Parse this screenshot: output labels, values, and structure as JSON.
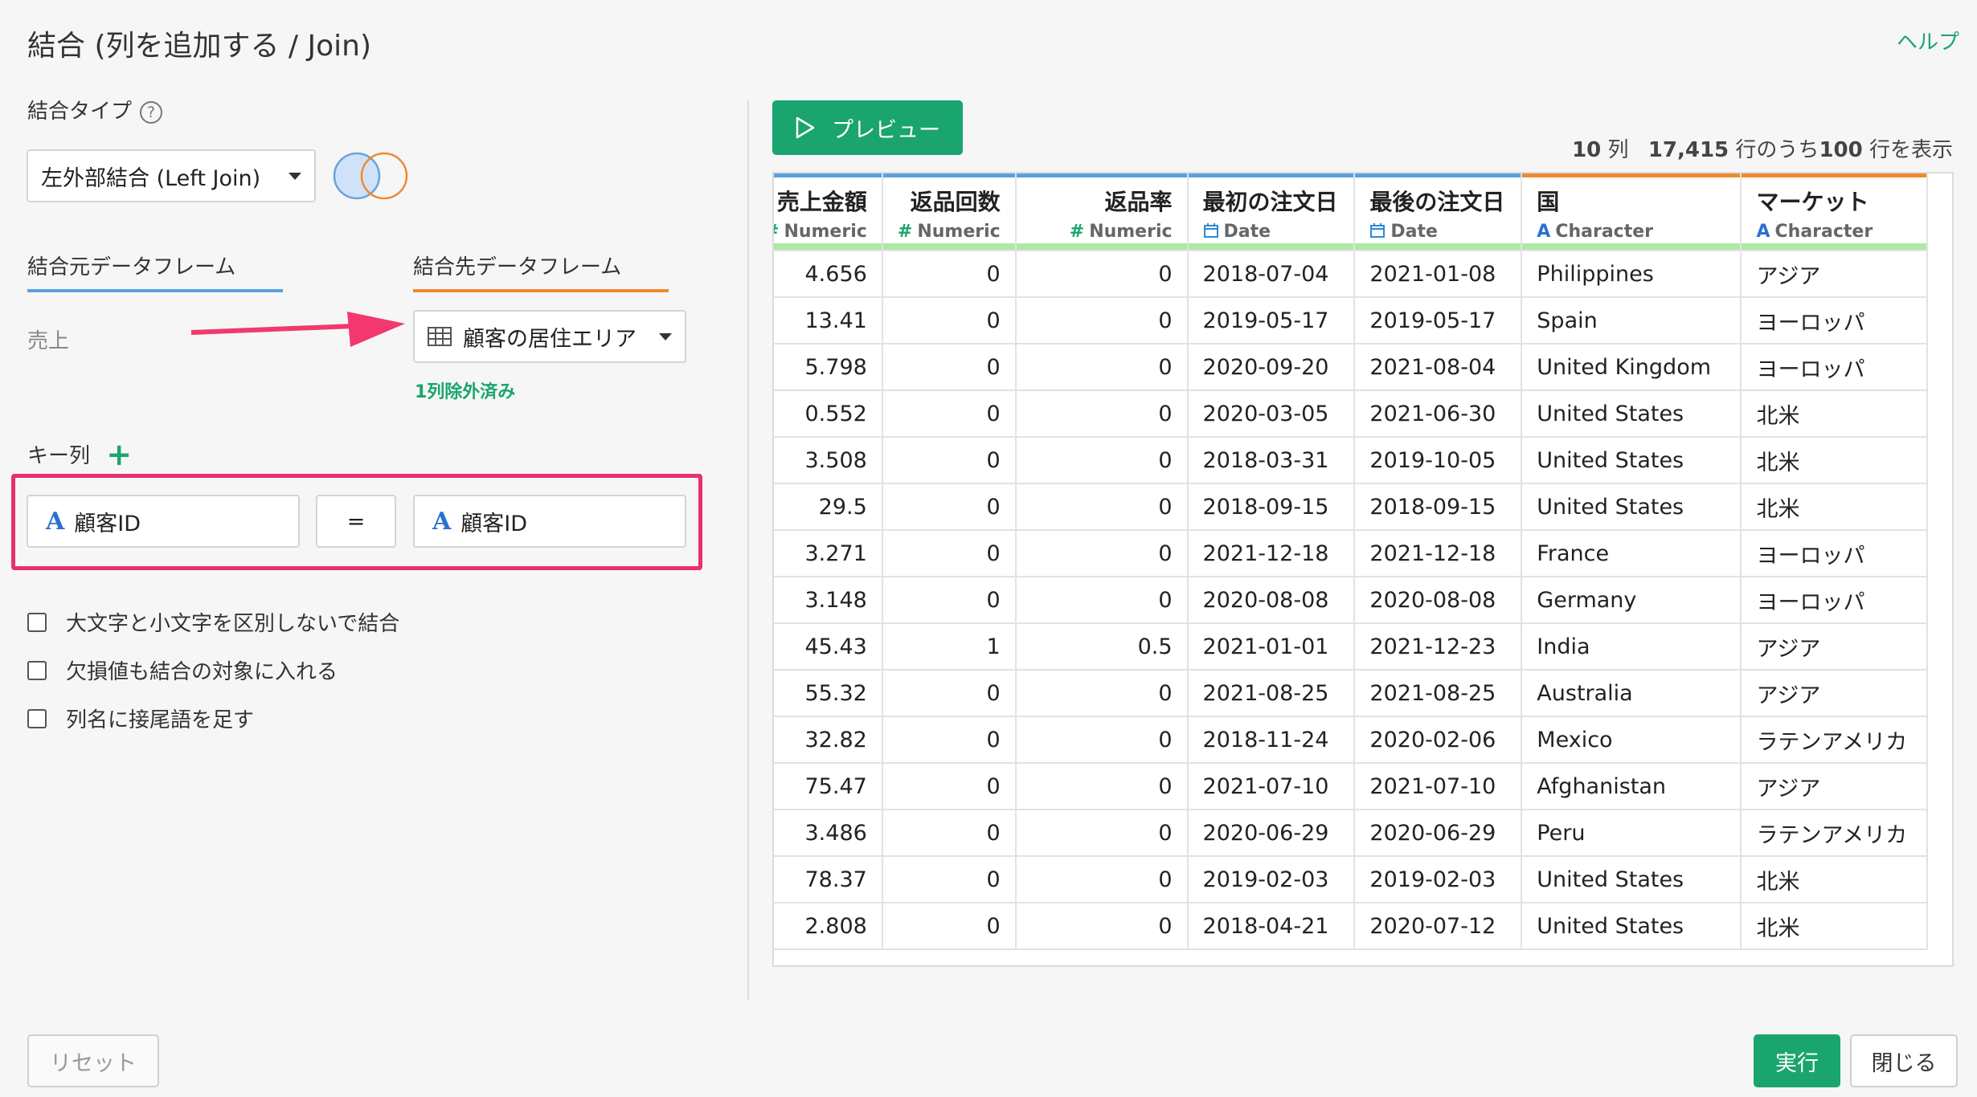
{
  "dialog": {
    "title": "結合 (列を追加する / Join)",
    "help": "ヘルプ"
  },
  "join_type": {
    "label": "結合タイプ",
    "help_icon": "?",
    "selected": "左外部結合 (Left Join)"
  },
  "frames": {
    "source_tab": "結合元データフレーム",
    "target_tab": "結合先データフレーム",
    "source_value": "売上",
    "target_value": "顧客の居住エリア",
    "excluded_note": "1列除外済み"
  },
  "keys": {
    "label": "キー列",
    "add_icon": "+",
    "left_key": "顧客ID",
    "operator": "=",
    "right_key": "顧客ID",
    "char_icon": "A"
  },
  "options": [
    {
      "label": "大文字と小文字を区別しないで結合",
      "checked": false
    },
    {
      "label": "欠損値も結合の対象に入れる",
      "checked": false
    },
    {
      "label": "列名に接尾語を足す",
      "checked": false
    }
  ],
  "preview": {
    "button_label": "プレビュー",
    "summary_cols": "10",
    "summary_cols_unit": "列",
    "summary_rows": "17,415",
    "summary_mid": "行のうち",
    "summary_shown": "100",
    "summary_tail": "行を表示"
  },
  "table": {
    "columns": [
      {
        "name": "売上金額",
        "type": "Numeric",
        "type_icon": "#",
        "accent": "#5aa0e0",
        "align": "right"
      },
      {
        "name": "返品回数",
        "type": "Numeric",
        "type_icon": "#",
        "accent": "#5aa0e0",
        "align": "right"
      },
      {
        "name": "返品率",
        "type": "Numeric",
        "type_icon": "#",
        "accent": "#5aa0e0",
        "align": "right"
      },
      {
        "name": "最初の注文日",
        "type": "Date",
        "type_icon": "calendar",
        "accent": "#5aa0e0",
        "align": "left"
      },
      {
        "name": "最後の注文日",
        "type": "Date",
        "type_icon": "calendar",
        "accent": "#5aa0e0",
        "align": "left"
      },
      {
        "name": "国",
        "type": "Character",
        "type_icon": "A",
        "accent": "#ef8a2e",
        "align": "left"
      },
      {
        "name": "マーケット",
        "type": "Character",
        "type_icon": "A",
        "accent": "#ef8a2e",
        "align": "left"
      }
    ],
    "rows": [
      [
        "4.656",
        "0",
        "0",
        "2018-07-04",
        "2021-01-08",
        "Philippines",
        "アジア"
      ],
      [
        "13.41",
        "0",
        "0",
        "2019-05-17",
        "2019-05-17",
        "Spain",
        "ヨーロッパ"
      ],
      [
        "5.798",
        "0",
        "0",
        "2020-09-20",
        "2021-08-04",
        "United Kingdom",
        "ヨーロッパ"
      ],
      [
        "0.552",
        "0",
        "0",
        "2020-03-05",
        "2021-06-30",
        "United States",
        "北米"
      ],
      [
        "3.508",
        "0",
        "0",
        "2018-03-31",
        "2019-10-05",
        "United States",
        "北米"
      ],
      [
        "29.5",
        "0",
        "0",
        "2018-09-15",
        "2018-09-15",
        "United States",
        "北米"
      ],
      [
        "3.271",
        "0",
        "0",
        "2021-12-18",
        "2021-12-18",
        "France",
        "ヨーロッパ"
      ],
      [
        "3.148",
        "0",
        "0",
        "2020-08-08",
        "2020-08-08",
        "Germany",
        "ヨーロッパ"
      ],
      [
        "45.43",
        "1",
        "0.5",
        "2021-01-01",
        "2021-12-23",
        "India",
        "アジア"
      ],
      [
        "55.32",
        "0",
        "0",
        "2021-08-25",
        "2021-08-25",
        "Australia",
        "アジア"
      ],
      [
        "32.82",
        "0",
        "0",
        "2018-11-24",
        "2020-02-06",
        "Mexico",
        "ラテンアメリカ"
      ],
      [
        "75.47",
        "0",
        "0",
        "2021-07-10",
        "2021-07-10",
        "Afghanistan",
        "アジア"
      ],
      [
        "3.486",
        "0",
        "0",
        "2020-06-29",
        "2020-06-29",
        "Peru",
        "ラテンアメリカ"
      ],
      [
        "78.37",
        "0",
        "0",
        "2019-02-03",
        "2019-02-03",
        "United States",
        "北米"
      ],
      [
        "2.808",
        "0",
        "0",
        "2018-04-21",
        "2020-07-12",
        "United States",
        "北米"
      ]
    ]
  },
  "footer": {
    "reset": "リセット",
    "run": "実行",
    "close": "閉じる"
  },
  "colors": {
    "accent_green": "#1aa56e",
    "highlight_pink": "#e8306f",
    "arrow_pink": "#f2386f"
  }
}
